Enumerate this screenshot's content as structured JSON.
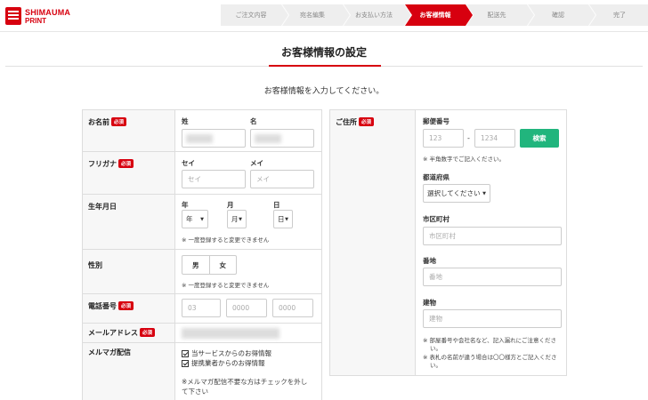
{
  "logo": {
    "line1": "SHIMAUMA",
    "line2": "PRINT"
  },
  "steps": [
    {
      "label": "ご注文内容",
      "active": false
    },
    {
      "label": "宛名編集",
      "active": false
    },
    {
      "label": "お支払い方法",
      "active": false
    },
    {
      "label": "お客様情報",
      "active": true
    },
    {
      "label": "配送先",
      "active": false
    },
    {
      "label": "確認",
      "active": false
    },
    {
      "label": "完了",
      "active": false
    }
  ],
  "page": {
    "title": "お客様情報の設定",
    "subtitle": "お客様情報を入力してください。"
  },
  "required_badge": "必須",
  "name": {
    "label": "お名前",
    "last_label": "姓",
    "first_label": "名"
  },
  "furigana": {
    "label": "フリガナ",
    "sei_label": "セイ",
    "mei_label": "メイ",
    "sei_placeholder": "セイ",
    "mei_placeholder": "メイ"
  },
  "birthdate": {
    "label": "生年月日",
    "year_label": "年",
    "month_label": "月",
    "day_label": "日",
    "year_value": "年",
    "month_value": "月",
    "day_value": "日",
    "note": "※ 一度登録すると変更できません"
  },
  "gender": {
    "label": "性別",
    "male": "男",
    "female": "女",
    "note": "※ 一度登録すると変更できません"
  },
  "phone": {
    "label": "電話番号",
    "p1": "03",
    "p2": "0000",
    "p3": "0000"
  },
  "email": {
    "label": "メールアドレス"
  },
  "newsletter": {
    "label": "メルマガ配信",
    "option1": "当サービスからのお得情報",
    "option2": "提携業者からのお得情報",
    "note1": "※メルマガ配信不要な方はチェックを外し",
    "note2": "て下さい"
  },
  "address": {
    "label": "ご住所",
    "postal_label": "郵便番号",
    "postal1_placeholder": "123",
    "postal2_placeholder": "1234",
    "dash": "-",
    "search_button": "検索",
    "postal_note": "※ 半角数字でご記入ください。",
    "pref_label": "都道府県",
    "pref_value": "選択してください",
    "city_label": "市区町村",
    "city_placeholder": "市区町村",
    "street_label": "番地",
    "street_placeholder": "番地",
    "building_label": "建物",
    "building_placeholder": "建物",
    "note1": "※ 部屋番号や会社名など、記入漏れにご注意くださ",
    "note1b": "い。",
    "note2": "※ 表札の名前が違う場合は〇〇様方とご記入くださ",
    "note2b": "い。"
  },
  "colors": {
    "accent": "#d7000f",
    "search": "#21b57d"
  }
}
